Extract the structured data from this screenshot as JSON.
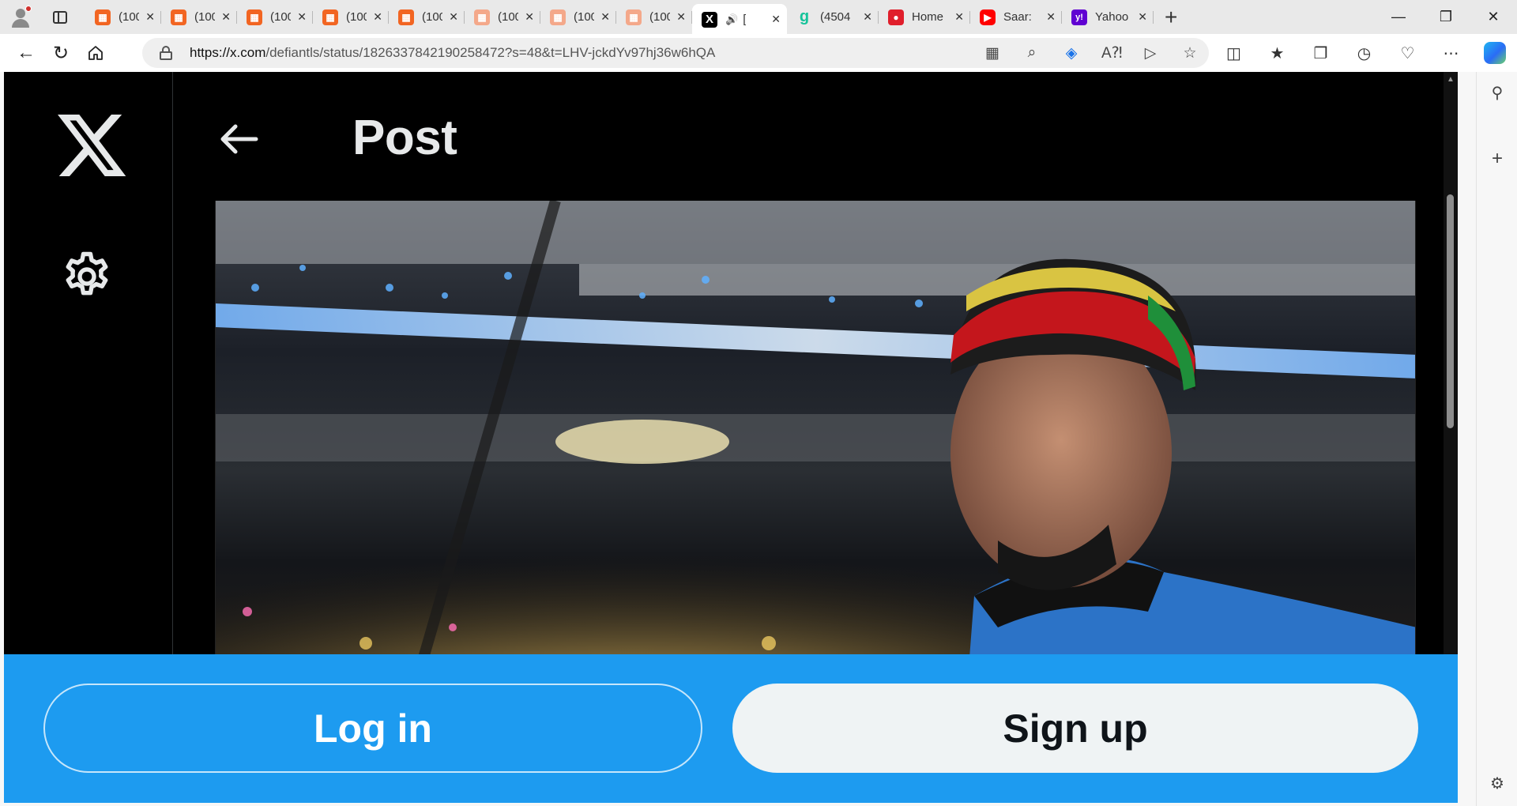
{
  "browser": {
    "tabs": [
      {
        "title": "(100)",
        "favicon": "substack-icon",
        "dim": false
      },
      {
        "title": "(100)",
        "favicon": "substack-icon",
        "dim": false
      },
      {
        "title": "(100)",
        "favicon": "substack-icon",
        "dim": false
      },
      {
        "title": "(100)",
        "favicon": "substack-icon",
        "dim": false
      },
      {
        "title": "(100)",
        "favicon": "substack-icon",
        "dim": false
      },
      {
        "title": "(100)",
        "favicon": "substack-icon",
        "dim": true
      },
      {
        "title": "(100)",
        "favicon": "substack-icon",
        "dim": true
      },
      {
        "title": "(100)",
        "favicon": "substack-icon",
        "dim": true
      },
      {
        "title": "[",
        "favicon": "x-icon",
        "active": true,
        "audio": true
      },
      {
        "title": "(4504",
        "favicon": "grammarly-icon"
      },
      {
        "title": "Home",
        "favicon": "news-icon"
      },
      {
        "title": "Saar:",
        "favicon": "youtube-icon"
      },
      {
        "title": "Yahoo",
        "favicon": "yahoo-icon"
      }
    ],
    "url_host": "https://x.com",
    "url_path": "/defiantls/status/1826337842190258472?s=48&t=LHV-jckdYv97hj36w6hQA",
    "accent_color": "#1d9bf0"
  },
  "page": {
    "title": "Post",
    "login_label": "Log in",
    "signup_label": "Sign up"
  }
}
